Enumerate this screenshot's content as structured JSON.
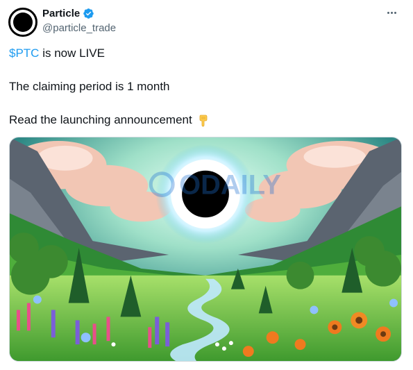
{
  "author": {
    "display_name": "Particle",
    "handle": "@particle_trade",
    "verified_icon": "verified-badge-icon",
    "avatar_icon": "black-circle-logo"
  },
  "tweet": {
    "cashtag": "$PTC",
    "line1_rest": " is now LIVE",
    "line2": "The claiming period is 1 month",
    "line3": "Read the launching announcement",
    "emoji_icon": "backhand-index-pointing-down-icon"
  },
  "media": {
    "description_icon": "pixel-art-valley-image",
    "watermark": "ODAILY"
  },
  "colors": {
    "accent": "#1d9bf0",
    "text": "#0f1419",
    "secondary": "#536471",
    "border": "#cfd9de"
  }
}
